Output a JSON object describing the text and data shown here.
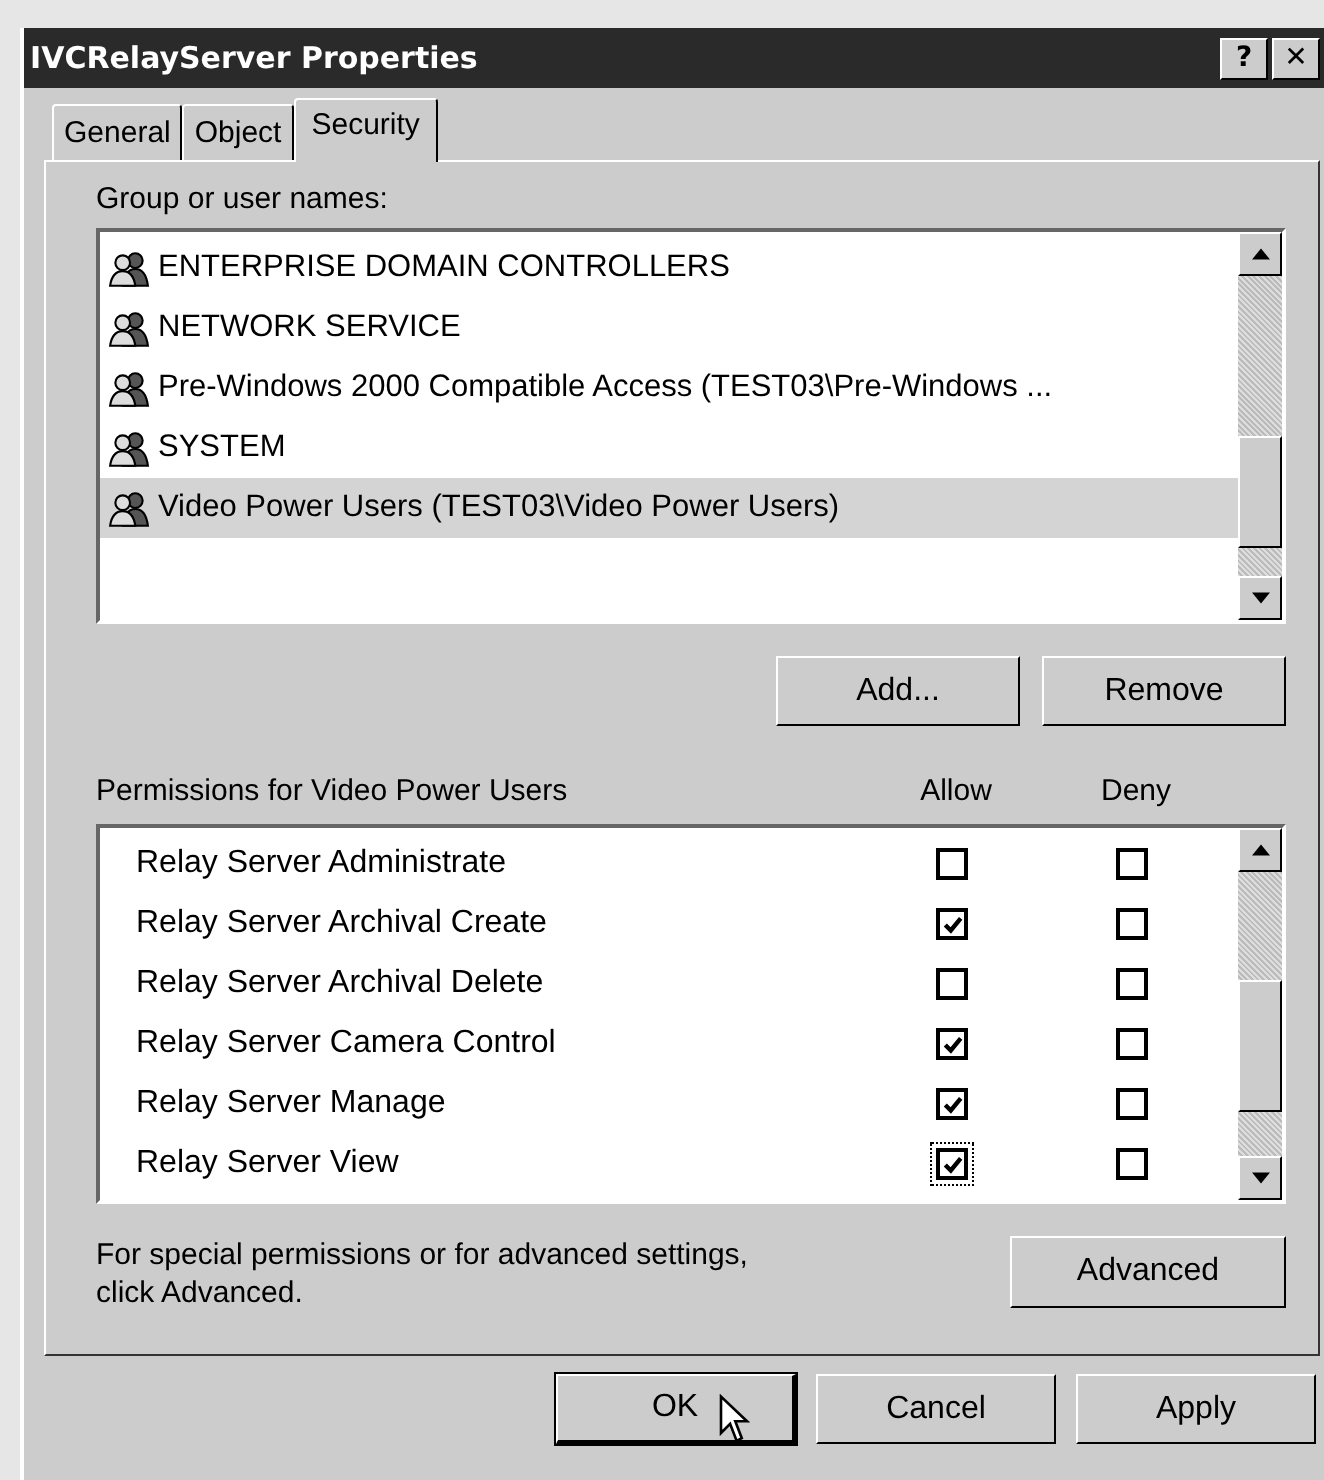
{
  "window": {
    "title": "IVCRelayServer Properties",
    "help_button": "?",
    "close_button": "✕"
  },
  "tabs": [
    {
      "label": "General",
      "selected": false
    },
    {
      "label": "Object",
      "selected": false
    },
    {
      "label": "Security",
      "selected": true
    }
  ],
  "group_list": {
    "label": "Group or user names:",
    "items": [
      {
        "name": "ENTERPRISE DOMAIN CONTROLLERS",
        "selected": false
      },
      {
        "name": "NETWORK SERVICE",
        "selected": false
      },
      {
        "name": "Pre-Windows 2000 Compatible Access (TEST03\\Pre-Windows ...",
        "selected": false
      },
      {
        "name": "SYSTEM",
        "selected": false
      },
      {
        "name": "Video Power Users (TEST03\\Video Power Users)",
        "selected": true
      }
    ]
  },
  "list_buttons": [
    "Add...",
    "Remove"
  ],
  "permissions": {
    "label": "Permissions for Video Power Users",
    "allow_header": "Allow",
    "deny_header": "Deny",
    "rows": [
      {
        "name": "Relay Server Administrate",
        "allow": false,
        "deny": false,
        "focused": false
      },
      {
        "name": "Relay Server Archival Create",
        "allow": true,
        "deny": false,
        "focused": false
      },
      {
        "name": "Relay Server Archival Delete",
        "allow": false,
        "deny": false,
        "focused": false
      },
      {
        "name": "Relay Server Camera Control",
        "allow": true,
        "deny": false,
        "focused": false
      },
      {
        "name": "Relay Server Manage",
        "allow": true,
        "deny": false,
        "focused": false
      },
      {
        "name": "Relay Server View",
        "allow": true,
        "deny": false,
        "focused": true
      }
    ]
  },
  "advanced_note": "For special permissions or for advanced settings, click Advanced.",
  "advanced_button": "Advanced",
  "dialog_buttons": [
    {
      "label": "OK",
      "default": true
    },
    {
      "label": "Cancel",
      "default": false
    },
    {
      "label": "Apply",
      "default": false
    }
  ]
}
